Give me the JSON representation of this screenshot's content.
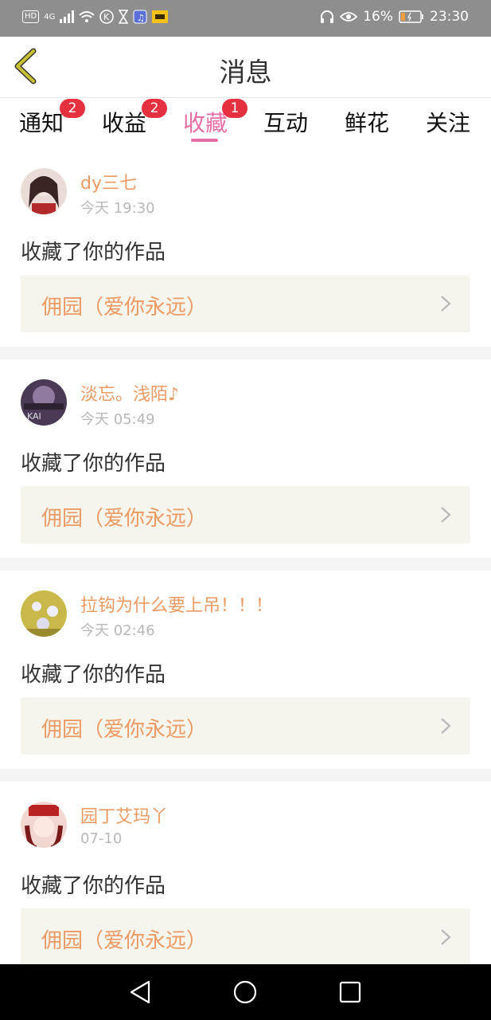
{
  "status_bar": {
    "hd": "HD",
    "network": "4G",
    "battery_percent": "16%",
    "time": "23:30",
    "icons": [
      "hd-icon",
      "signal-icon",
      "wifi-icon",
      "k-app-icon",
      "hourglass-icon",
      "music-app-icon",
      "meituan-icon",
      "headphones-icon",
      "eye-icon",
      "battery-icon"
    ]
  },
  "header": {
    "title": "消息",
    "back_icon": "chevron-left-icon",
    "accent_color": "#c8c033"
  },
  "tabs": [
    {
      "label": "通知",
      "badge": "2"
    },
    {
      "label": "收益",
      "badge": "2"
    },
    {
      "label": "收藏",
      "badge": "1",
      "active": true
    },
    {
      "label": "互动",
      "badge": ""
    },
    {
      "label": "鲜花",
      "badge": ""
    },
    {
      "label": "关注",
      "badge": ""
    }
  ],
  "colors": {
    "active_tab": "#e76da5",
    "username": "#ec9a63",
    "badge": "#e5303f",
    "work_bg": "#f5f4ed"
  },
  "messages": [
    {
      "username": "dy三七",
      "time": "今天 19:30",
      "action": "收藏了你的作品",
      "work_title": "佣园（爱你永远）"
    },
    {
      "username": "淡忘。浅陌♪",
      "time": "今天 05:49",
      "action": "收藏了你的作品",
      "work_title": "佣园（爱你永远）"
    },
    {
      "username": "拉钩为什么要上吊！！！",
      "time": "今天 02:46",
      "action": "收藏了你的作品",
      "work_title": "佣园（爱你永远）"
    },
    {
      "username": "园丁艾玛丫",
      "time": "07-10",
      "action": "收藏了你的作品",
      "work_title": "佣园（爱你永远）"
    }
  ],
  "nav_bar": {
    "icons": [
      "back-triangle-icon",
      "home-circle-icon",
      "recents-square-icon"
    ]
  }
}
